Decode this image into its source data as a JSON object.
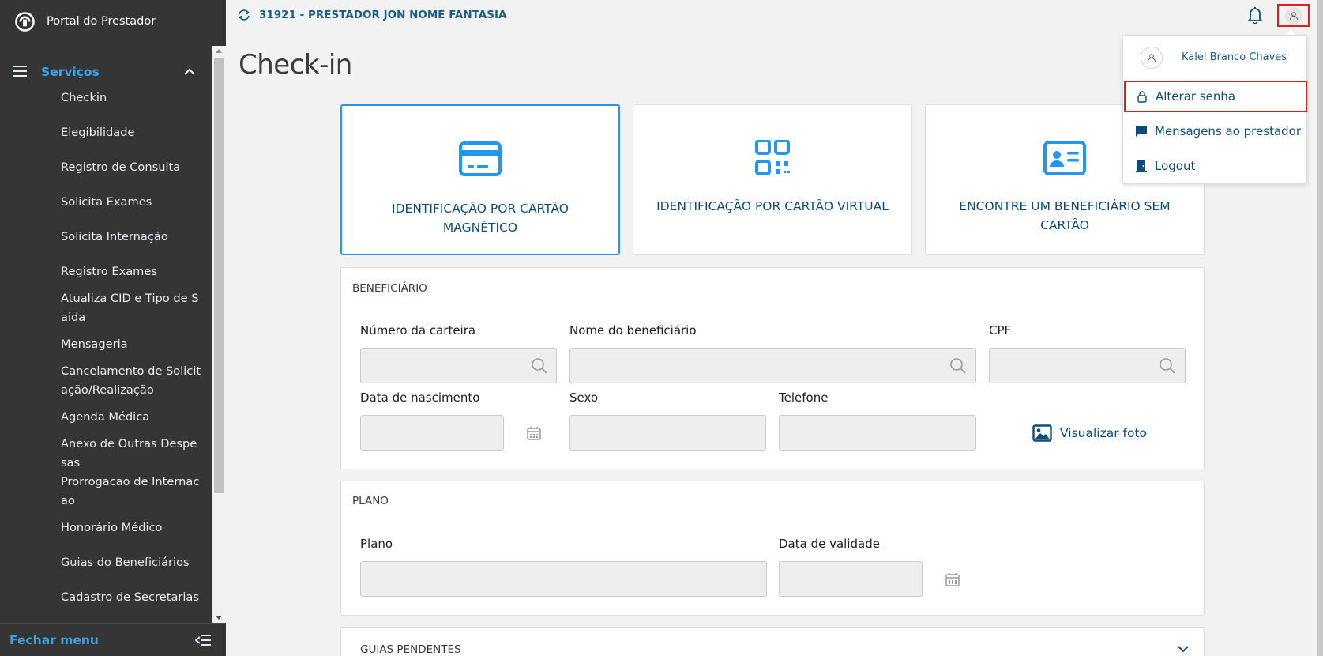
{
  "sidebar": {
    "brand": "Portal do Prestador",
    "section_label": "Serviços",
    "items": [
      "Checkin",
      "Elegibilidade",
      "Registro de Consulta",
      "Solicita Exames",
      "Solicita Internação",
      "Registro Exames",
      "Atualiza CID e Tipo de S aida",
      "Mensageria",
      "Cancelamento de Solicit ação/Realização",
      "Agenda Médica",
      "Anexo de Outras Despe sas",
      "Prorrogacao de Internac ao",
      "Honorário Médico",
      "Guias do Beneficiários",
      "Cadastro de Secretarias"
    ],
    "footer_label": "Fechar menu"
  },
  "topbar": {
    "provider": "31921 - PRESTADOR JON NOME FANTASIA"
  },
  "page": {
    "title": "Check-in"
  },
  "cards": {
    "magnetic": "IDENTIFICAÇÃO POR CARTÃO MAGNÉTICO",
    "virtual": "IDENTIFICAÇÃO POR CARTÃO VIRTUAL",
    "no_card": "ENCONTRE UM BENEFICIÁRIO SEM CARTÃO"
  },
  "beneficiario": {
    "title": "BENEFICIÁRIO",
    "numero_label": "Número da carteira",
    "nome_label": "Nome do beneficiário",
    "cpf_label": "CPF",
    "nascimento_label": "Data de nascimento",
    "sexo_label": "Sexo",
    "telefone_label": "Telefone",
    "foto_label": "Visualizar foto"
  },
  "plano": {
    "title": "PLANO",
    "plano_label": "Plano",
    "validade_label": "Data de validade"
  },
  "guias": {
    "title": "GUIAS PENDENTES"
  },
  "user_menu": {
    "username": "Kalel Branco Chaves",
    "items": [
      "Alterar senha",
      "Mensagens ao prestador",
      "Logout"
    ]
  },
  "colors": {
    "sidebar_bg": "#353535",
    "accent": "#2196f3",
    "link": "#0c4d7c",
    "highlight": "#e11d1d"
  }
}
